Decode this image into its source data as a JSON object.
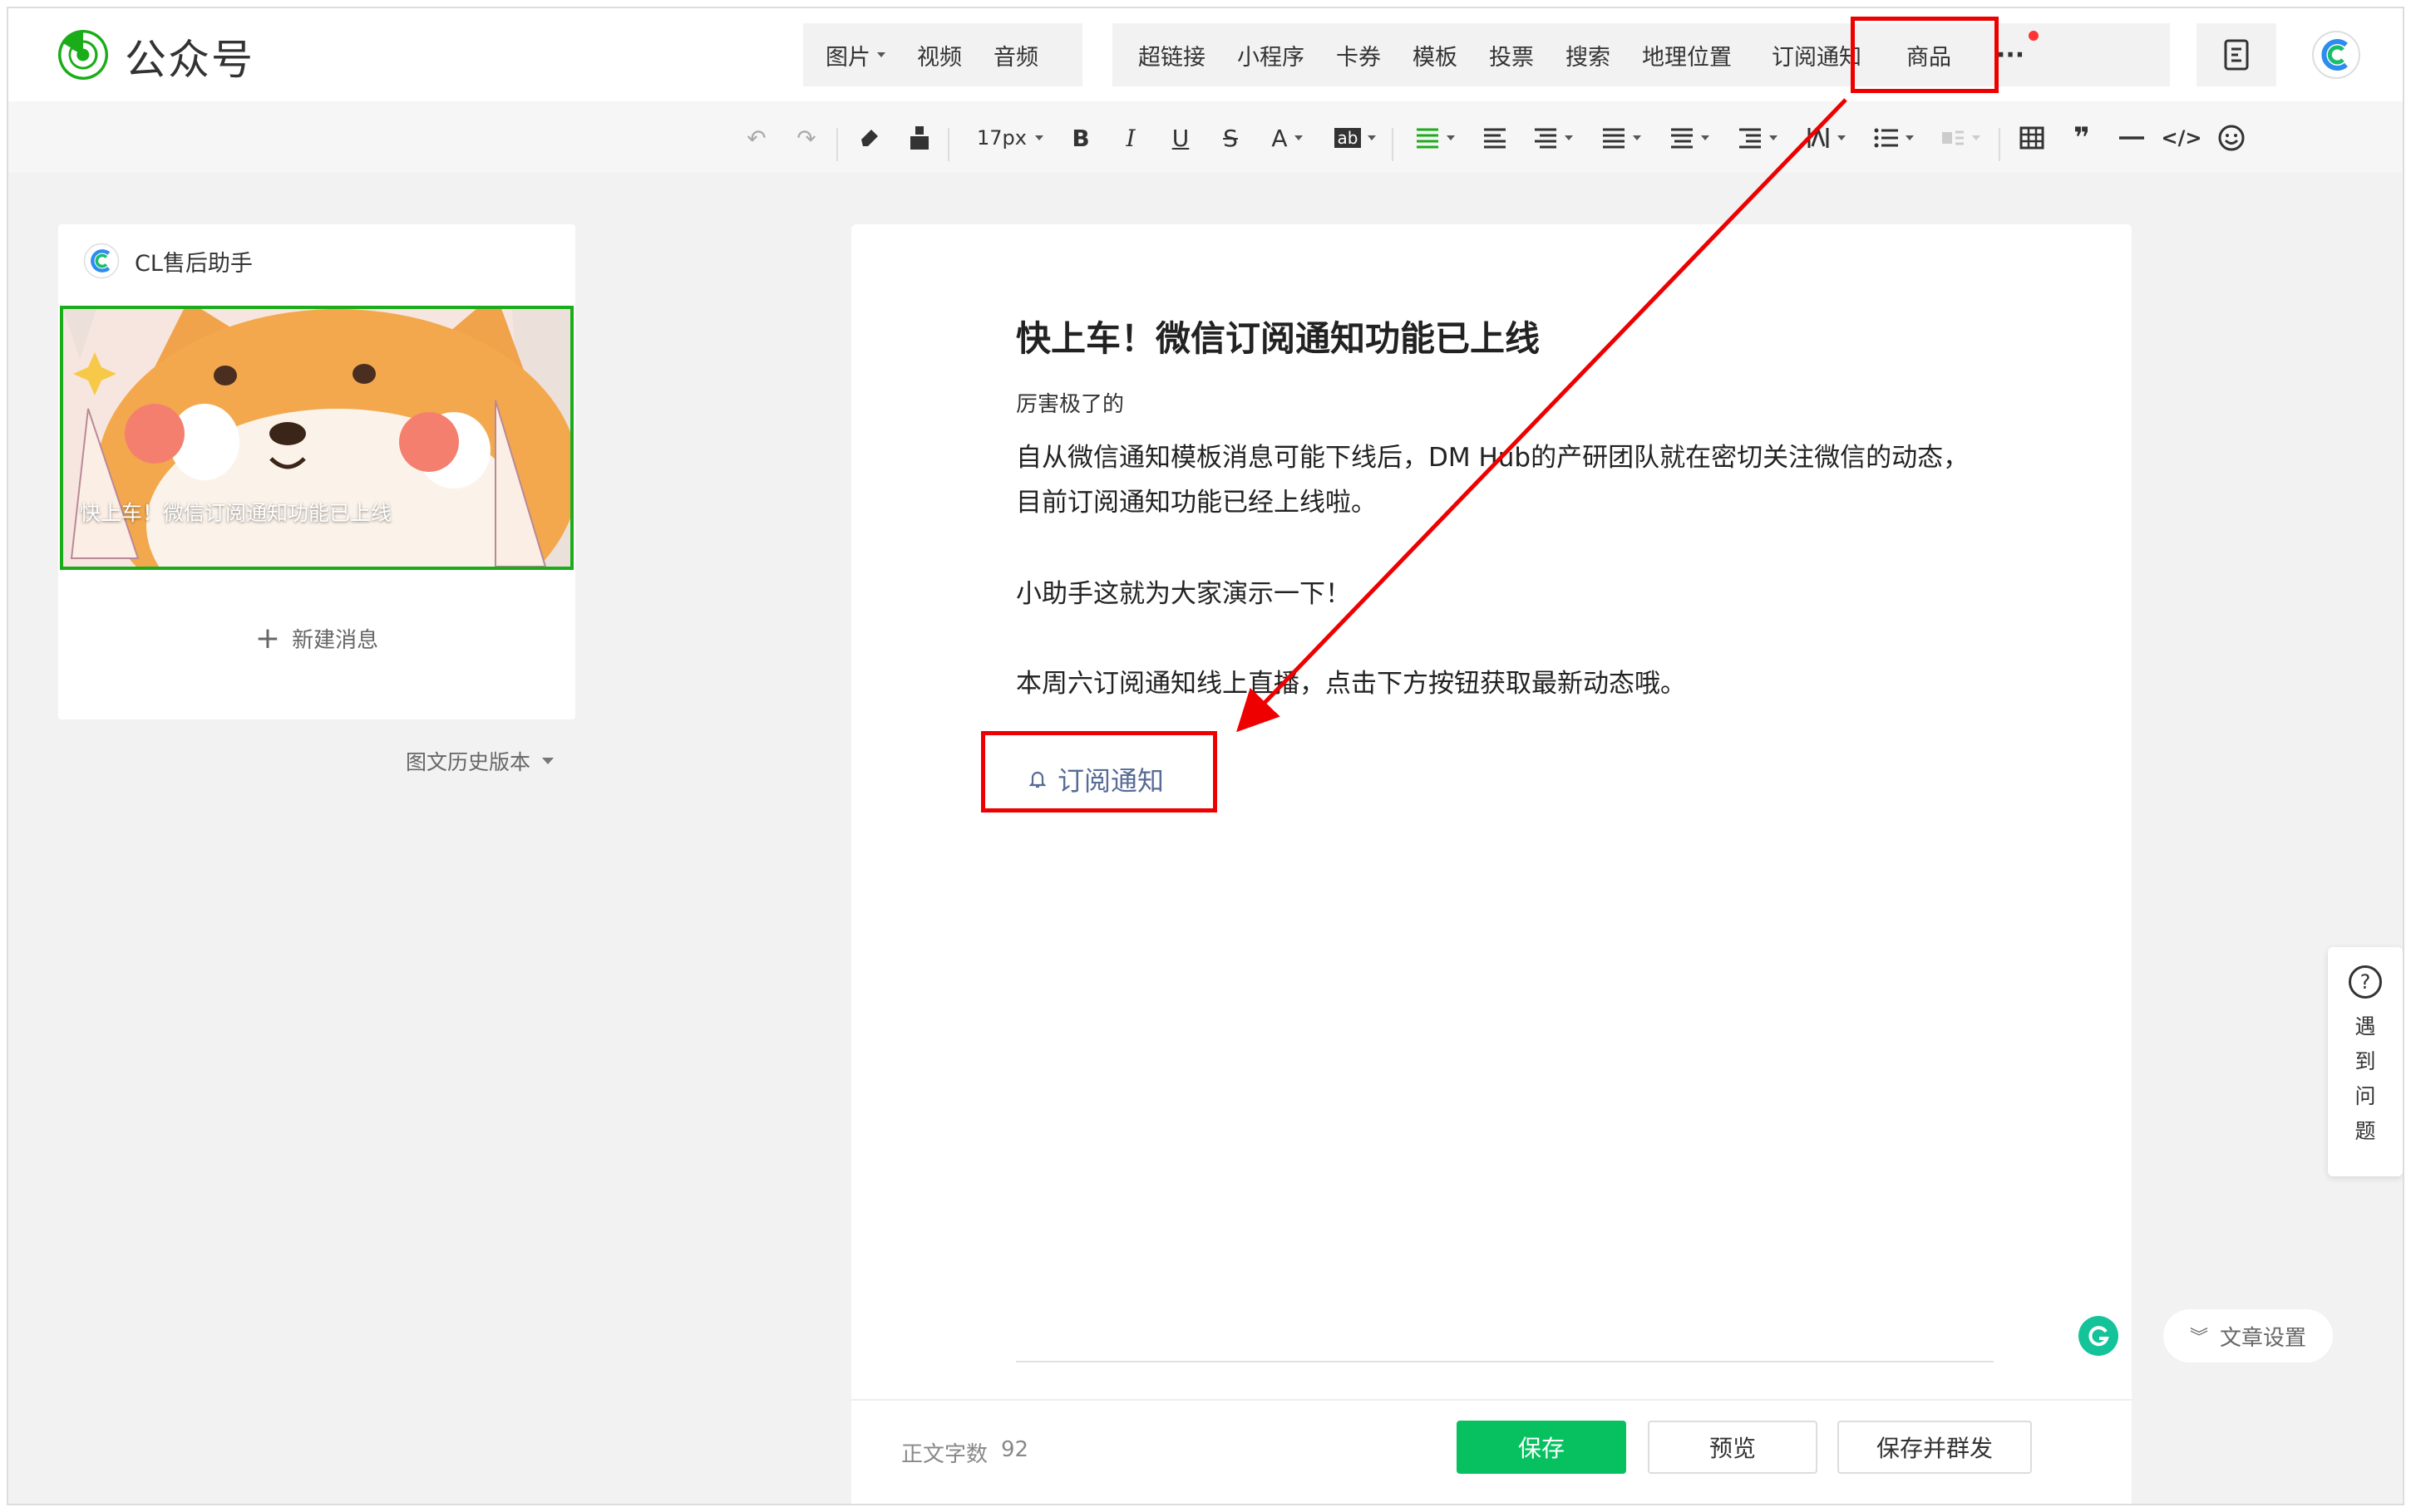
{
  "app": {
    "name": "公众号"
  },
  "toolbar_groups": {
    "media": [
      "图片",
      "视频",
      "音频"
    ],
    "insert": [
      "超链接",
      "小程序",
      "卡券",
      "模板",
      "投票",
      "搜索",
      "地理位置",
      "订阅通知",
      "商品"
    ],
    "more_label": "···"
  },
  "format_toolbar": {
    "font_size": "17px",
    "bold": "B",
    "italic": "I",
    "underline": "U",
    "strike": "S",
    "font_color": "A",
    "highlight": "ab",
    "quote": "❞"
  },
  "sidebar": {
    "account_name": "CL售后助手",
    "article_cover_title": "快上车！微信订阅通知功能已上线",
    "new_message": "新建消息",
    "history": "图文历史版本"
  },
  "article": {
    "title": "快上车！微信订阅通知功能已上线",
    "author": "厉害极了的",
    "paragraphs": [
      "自从微信通知模板消息可能下线后，DM Hub的产研团队就在密切关注微信的动态，目前订阅通知功能已经上线啦。",
      "小助手这就为大家演示一下！",
      "本周六订阅通知线上直播，点击下方按钮获取最新动态哦。"
    ],
    "subscribe_button": "订阅通知"
  },
  "footer": {
    "word_count_label": "正文字数",
    "word_count": "92",
    "save": "保存",
    "preview": "预览",
    "save_publish": "保存并群发"
  },
  "side_help": {
    "chars": [
      "遇",
      "到",
      "问",
      "题"
    ],
    "icon": "?"
  },
  "article_settings": "文章设置",
  "colors": {
    "brand_green": "#1aad19",
    "save_green": "#07c160",
    "annotation_red": "#e00000",
    "link_blue": "#576b95"
  }
}
